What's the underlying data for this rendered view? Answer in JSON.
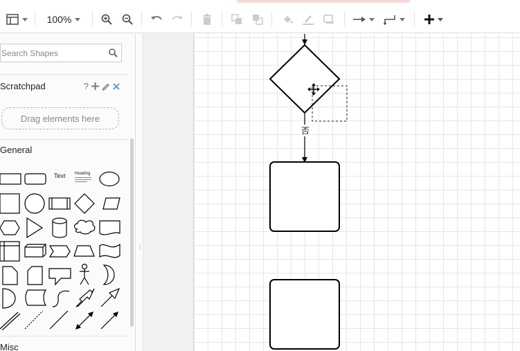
{
  "toolbar": {
    "zoom": "100%",
    "icons": [
      "format-panel-icon",
      "zoom-in-icon",
      "zoom-out-icon",
      "undo-icon",
      "redo-icon",
      "delete-icon",
      "to-front-icon",
      "to-back-icon",
      "fill-color-icon",
      "line-color-icon",
      "shadow-icon",
      "connection-icon",
      "waypoints-icon",
      "insert-icon"
    ]
  },
  "sidebar": {
    "search_placeholder": "Search Shapes",
    "scratchpad": {
      "title": "Scratchpad",
      "help": "?",
      "drop_hint": "Drag elements here"
    },
    "general": {
      "title": "General",
      "text_shape_label": "Text",
      "heading_shape_label": "Heading"
    },
    "misc": {
      "title": "Misc"
    }
  },
  "canvas": {
    "edge_label": "否"
  },
  "colors": {
    "grid": "#e6e6e6",
    "stroke": "#000000",
    "toolbar_border": "#dadada"
  }
}
